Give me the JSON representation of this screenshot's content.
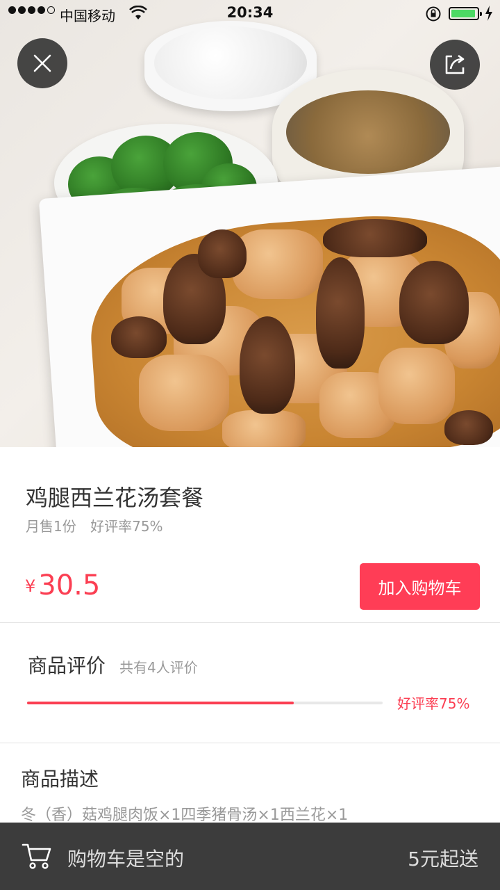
{
  "status_bar": {
    "carrier": "中国移动",
    "time": "20:34",
    "battery_level": 0.9
  },
  "hero": {
    "close_icon": "close-icon",
    "share_icon": "share-icon",
    "image_subject": "food-photo"
  },
  "dish": {
    "name": "鸡腿西兰花汤套餐",
    "monthly_sales": "月售1份",
    "positive_rate": "好评率75%",
    "currency": "¥",
    "price": "30.5",
    "add_to_cart": "加入购物车"
  },
  "reviews": {
    "title": "商品评价",
    "count": "共有4人评价",
    "rating_fraction": 0.75,
    "rating_label": "好评率75%"
  },
  "description": {
    "title": "商品描述",
    "text": "冬（香）菇鸡腿肉饭×1四季猪骨汤×1西兰花×1"
  },
  "cart_bar": {
    "cart_icon": "cart-icon",
    "empty_text": "购物车是空的",
    "min_order": "5元起送"
  },
  "colors": {
    "accent": "#fb3e52",
    "cart_bar": "#3c3c3c"
  }
}
